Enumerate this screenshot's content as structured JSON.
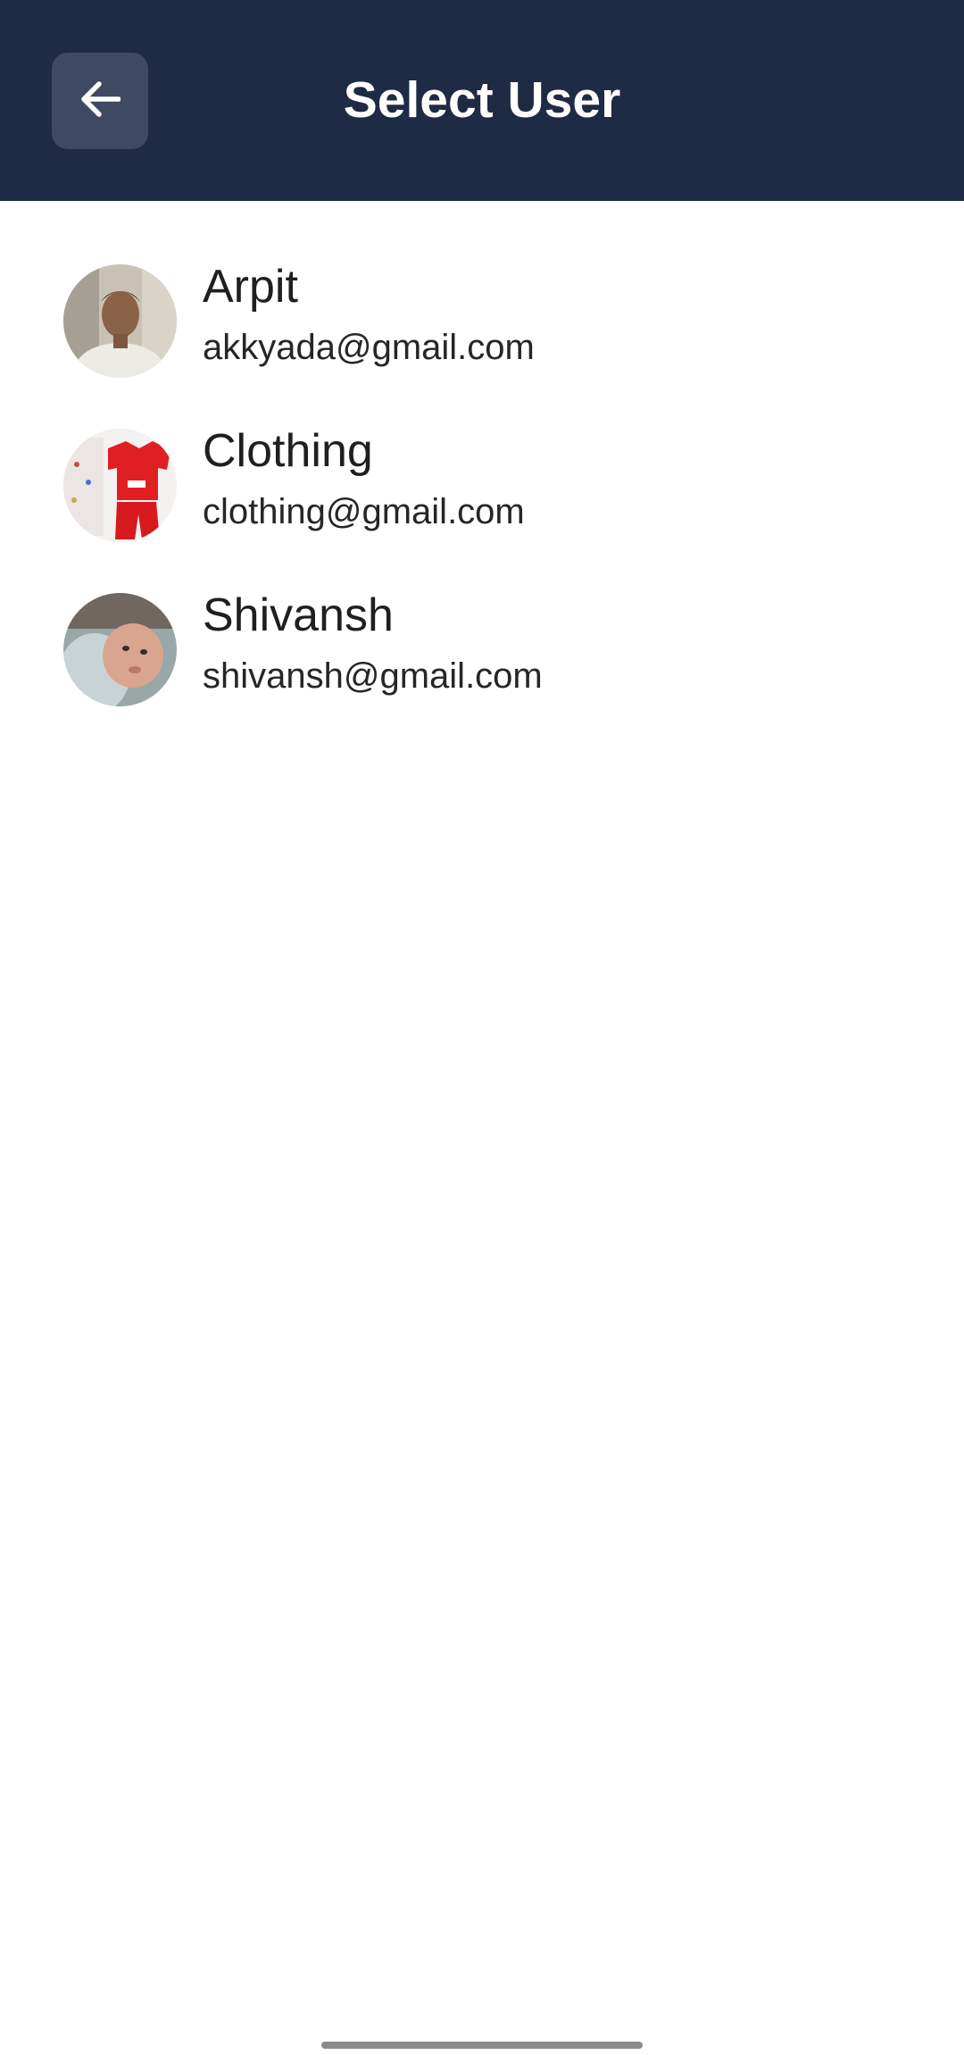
{
  "header": {
    "title": "Select User",
    "back_icon": "arrow-left-icon",
    "background": "#1e2b45",
    "button_background": "#3d4a61"
  },
  "users": [
    {
      "name": "Arpit",
      "email": "akkyada@gmail.com",
      "avatar": "photo of a young man"
    },
    {
      "name": "Clothing",
      "email": "clothing@gmail.com",
      "avatar": "photo of red kids clothing"
    },
    {
      "name": "Shivansh",
      "email": "shivansh@gmail.com",
      "avatar": "photo of a baby"
    }
  ]
}
